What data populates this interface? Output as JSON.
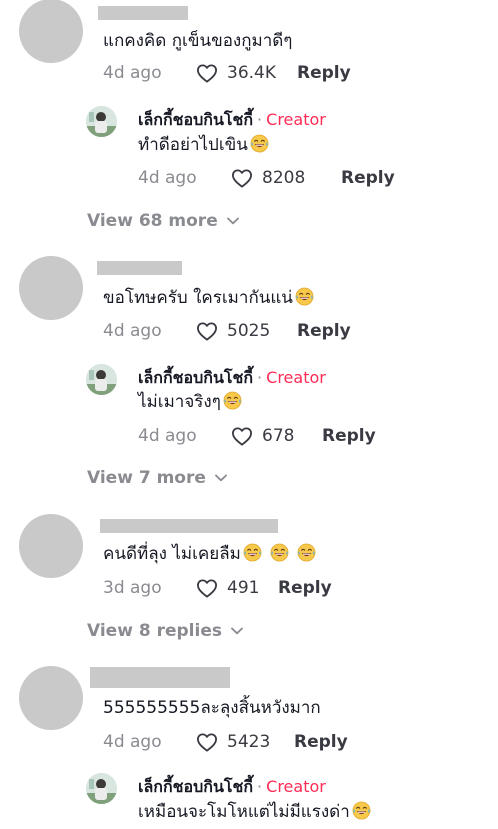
{
  "comments": [
    {
      "text": "แกคงคิด กูเข็นของกูมาดีๆ",
      "emoji_count": 0,
      "time": "4d ago",
      "likes": "36.4K",
      "reply": "Reply",
      "creator_reply": {
        "name": "เล็กกี้ชอบกินโชกี้",
        "sep": "·",
        "badge": "Creator",
        "text": "ทำดีอย่าไปเขิน",
        "emoji_count": 1,
        "time": "4d ago",
        "likes": "8208",
        "reply": "Reply"
      },
      "view_more": "View 68 more"
    },
    {
      "text": "ขอโทษครับ ใครเมากันแน่",
      "emoji_count": 1,
      "time": "4d ago",
      "likes": "5025",
      "reply": "Reply",
      "creator_reply": {
        "name": "เล็กกี้ชอบกินโชกี้",
        "sep": "·",
        "badge": "Creator",
        "text": "ไม่เมาจริงๆ",
        "emoji_count": 1,
        "time": "4d ago",
        "likes": "678",
        "reply": "Reply"
      },
      "view_more": "View 7 more"
    },
    {
      "text": "คนดีที่ลุง ไม่เคยลืม",
      "emoji_count": 3,
      "time": "3d ago",
      "likes": "491",
      "reply": "Reply",
      "view_more": "View 8 replies"
    },
    {
      "text": "555555555ละลุงสิ้นหวังมาก",
      "emoji_count": 0,
      "time": "4d ago",
      "likes": "5423",
      "reply": "Reply",
      "creator_reply": {
        "name": "เล็กกี้ชอบกินโชกี้",
        "sep": "·",
        "badge": "Creator",
        "text": "เหมือนจะโมโหแต่ไม่มีแรงด่า",
        "emoji_count": 1
      }
    }
  ],
  "icons": {
    "like": "heart-outline-icon",
    "expand": "chevron-down-icon",
    "emoji": "face-tears-of-joy-emoji"
  },
  "colors": {
    "creator_badge": "#fe2c55",
    "secondary_text": "#8a8b91",
    "placeholder": "#c9c9c9"
  }
}
